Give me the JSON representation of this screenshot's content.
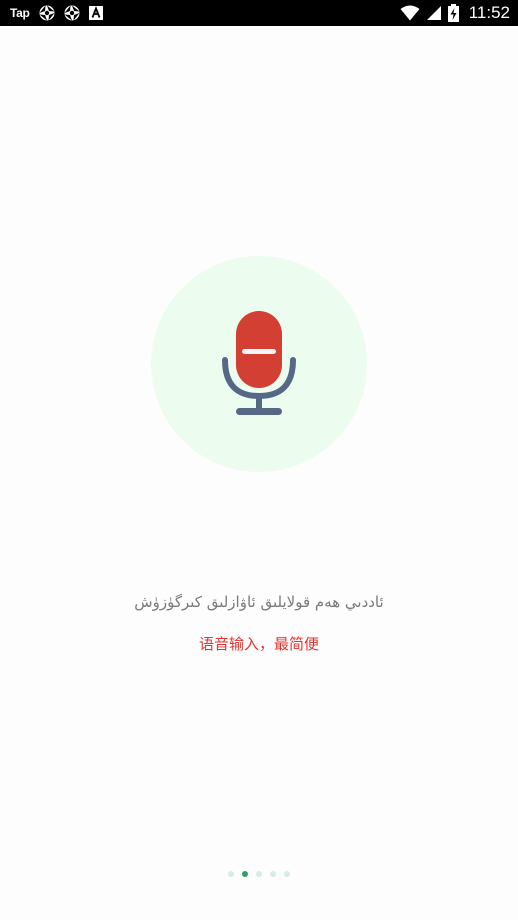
{
  "status_bar": {
    "app_label": "Tap",
    "time": "11:52",
    "icons": [
      "aperture-icon",
      "aperture-icon",
      "a-box-icon",
      "wifi-icon",
      "signal-icon",
      "battery-charging-icon"
    ]
  },
  "main": {
    "illustration_icon": "microphone-icon",
    "title": "ئاددىي ھەم قولايلىق ئاۋازلىق كىرگۈزۈش",
    "subtitle": "语音输入，最简便"
  },
  "pager": {
    "total": 5,
    "active_index": 1
  },
  "colors": {
    "circle_bg": "#ecfcee",
    "mic_head": "#d33f32",
    "mic_stand": "#556987",
    "subtitle": "#e2342e",
    "dot_active": "#2e9e6a",
    "dot_inactive": "#d6ede3"
  }
}
